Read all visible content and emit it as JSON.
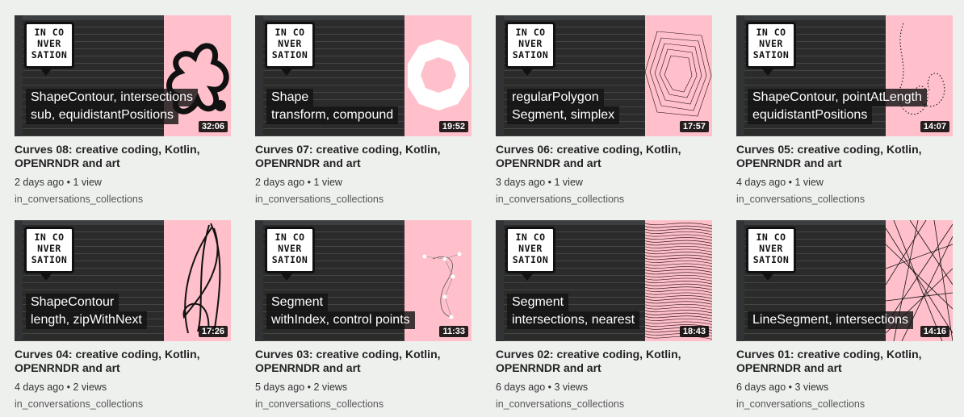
{
  "logo_lines": [
    "IN CO",
    "NVER",
    "SATION"
  ],
  "channel": "in_conversations_collections",
  "videos": [
    {
      "caption": [
        "ShapeContour, intersections",
        "sub, equidistantPositions"
      ],
      "duration": "32:06",
      "title": "Curves 08: creative coding, Kotlin, OPENRNDR and art",
      "age": "2 days ago",
      "views": "1 view",
      "art": "blob-icon"
    },
    {
      "caption": [
        "Shape",
        "transform, compound"
      ],
      "duration": "19:52",
      "title": "Curves 07: creative coding, Kotlin, OPENRNDR and art",
      "age": "2 days ago",
      "views": "1 view",
      "art": "ring-icon"
    },
    {
      "caption": [
        "regularPolygon",
        "Segment, simplex"
      ],
      "duration": "17:57",
      "title": "Curves 06: creative coding, Kotlin, OPENRNDR and art",
      "age": "3 days ago",
      "views": "1 view",
      "art": "polygon-mesh-icon"
    },
    {
      "caption": [
        "ShapeContour, pointAtLength",
        "equidistantPositions"
      ],
      "duration": "14:07",
      "title": "Curves 05: creative coding, Kotlin, OPENRNDR and art",
      "age": "4 days ago",
      "views": "1 view",
      "art": "dotted-curve-icon"
    },
    {
      "caption": [
        "ShapeContour",
        "length, zipWithNext"
      ],
      "duration": "17:26",
      "title": "Curves 04: creative coding, Kotlin, OPENRNDR and art",
      "age": "4 days ago",
      "views": "2 views",
      "art": "scribble-icon"
    },
    {
      "caption": [
        "Segment",
        "withIndex, control points"
      ],
      "duration": "11:33",
      "title": "Curves 03: creative coding, Kotlin, OPENRNDR and art",
      "age": "5 days ago",
      "views": "2 views",
      "art": "control-points-icon"
    },
    {
      "caption": [
        "Segment",
        "intersections, nearest"
      ],
      "duration": "18:43",
      "title": "Curves 02: creative coding, Kotlin, OPENRNDR and art",
      "age": "6 days ago",
      "views": "3 views",
      "art": "wave-lines-icon"
    },
    {
      "caption": [
        "LineSegment, intersections"
      ],
      "duration": "14:16",
      "title": "Curves 01: creative coding, Kotlin, OPENRNDR and art",
      "age": "6 days ago",
      "views": "3 views",
      "art": "crossing-lines-icon"
    }
  ]
}
